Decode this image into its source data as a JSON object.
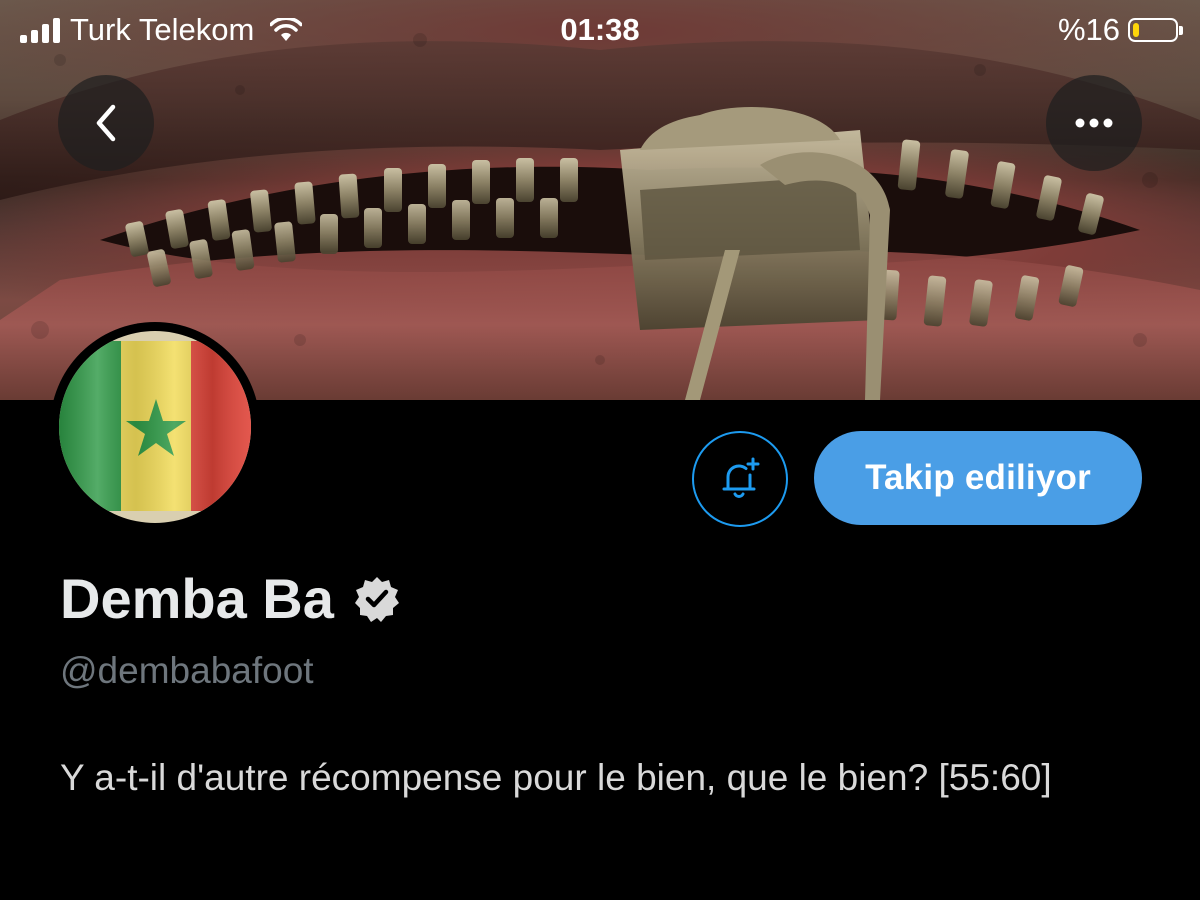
{
  "status_bar": {
    "carrier": "Turk Telekom",
    "time": "01:38",
    "battery_percent": "%16",
    "battery_level": 0.16
  },
  "header": {
    "back_icon": "chevron-left-icon",
    "more_icon": "more-horizontal-icon"
  },
  "profile": {
    "display_name": "Demba Ba",
    "verified": true,
    "handle": "@dembabafoot",
    "bio": "Y a-t-il d'autre récompense pour le bien, que le bien? [55:60]",
    "follow_button_label": "Takip ediliyor",
    "notify_icon": "bell-plus-icon"
  },
  "colors": {
    "accent": "#1d9bf0",
    "follow_button": "#4a9ee6",
    "background": "#000000",
    "handle_text": "#6e767d"
  }
}
